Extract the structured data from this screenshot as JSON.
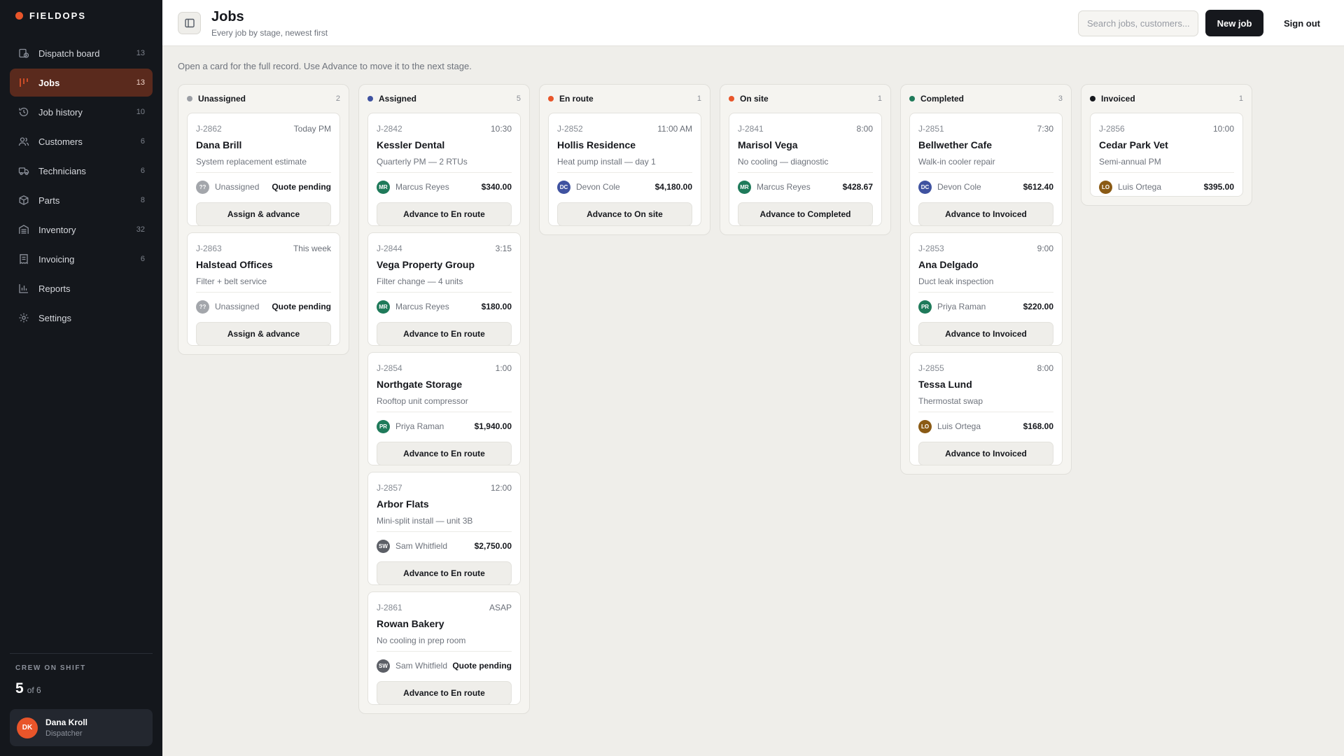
{
  "brand": {
    "name": "FIELDOPS",
    "dot_color": "#e8552a"
  },
  "sidebar": {
    "items": [
      {
        "label": "Dispatch board",
        "count": "13",
        "icon": "clock-board-icon"
      },
      {
        "label": "Jobs",
        "count": "13",
        "icon": "columns-icon",
        "active": true
      },
      {
        "label": "Job history",
        "count": "10",
        "icon": "history-icon"
      },
      {
        "label": "Customers",
        "count": "6",
        "icon": "users-icon"
      },
      {
        "label": "Technicians",
        "count": "6",
        "icon": "truck-icon"
      },
      {
        "label": "Parts",
        "count": "8",
        "icon": "box-icon"
      },
      {
        "label": "Inventory",
        "count": "32",
        "icon": "warehouse-icon"
      },
      {
        "label": "Invoicing",
        "count": "6",
        "icon": "receipt-icon"
      },
      {
        "label": "Reports",
        "count": "",
        "icon": "bar-chart-icon"
      },
      {
        "label": "Settings",
        "count": "",
        "icon": "gear-icon"
      }
    ],
    "crew_label": "CREW ON SHIFT",
    "crew_count": "5",
    "crew_total": "of 6",
    "user": {
      "initials": "DK",
      "name": "Dana Kroll",
      "role": "Dispatcher"
    }
  },
  "header": {
    "title": "Jobs",
    "subtitle": "Every job by stage, newest first",
    "search_placeholder": "Search jobs, customers...",
    "new_job_label": "New job",
    "sign_out_label": "Sign out"
  },
  "hint": "Open a card for the full record. Use Advance to move it to the next stage.",
  "board": [
    {
      "name": "Unassigned",
      "count": "2",
      "color": "#9b9ea4",
      "cards": [
        {
          "id": "J-2862",
          "time": "Today PM",
          "title": "Dana Brill",
          "desc": "System replacement estimate",
          "initials": "??",
          "tech": "Unassigned",
          "avatar_color": "#a3a6ab",
          "price": "Quote pending",
          "action": "Assign & advance"
        },
        {
          "id": "J-2863",
          "time": "This week",
          "title": "Halstead Offices",
          "desc": "Filter + belt service",
          "initials": "??",
          "tech": "Unassigned",
          "avatar_color": "#a3a6ab",
          "price": "Quote pending",
          "action": "Assign & advance"
        }
      ]
    },
    {
      "name": "Assigned",
      "count": "5",
      "color": "#3f52a0",
      "cards": [
        {
          "id": "J-2842",
          "time": "10:30",
          "title": "Kessler Dental",
          "desc": "Quarterly PM — 2 RTUs",
          "initials": "MR",
          "tech": "Marcus Reyes",
          "avatar_color": "#1f7a5a",
          "price": "$340.00",
          "action": "Advance to En route"
        },
        {
          "id": "J-2844",
          "time": "3:15",
          "title": "Vega Property Group",
          "desc": "Filter change — 4 units",
          "initials": "MR",
          "tech": "Marcus Reyes",
          "avatar_color": "#1f7a5a",
          "price": "$180.00",
          "action": "Advance to En route"
        },
        {
          "id": "J-2854",
          "time": "1:00",
          "title": "Northgate Storage",
          "desc": "Rooftop unit compressor",
          "initials": "PR",
          "tech": "Priya Raman",
          "avatar_color": "#1f7a5a",
          "price": "$1,940.00",
          "action": "Advance to En route"
        },
        {
          "id": "J-2857",
          "time": "12:00",
          "title": "Arbor Flats",
          "desc": "Mini-split install — unit 3B",
          "initials": "SW",
          "tech": "Sam Whitfield",
          "avatar_color": "#5c5f66",
          "price": "$2,750.00",
          "action": "Advance to En route"
        },
        {
          "id": "J-2861",
          "time": "ASAP",
          "title": "Rowan Bakery",
          "desc": "No cooling in prep room",
          "initials": "SW",
          "tech": "Sam Whitfield",
          "avatar_color": "#5c5f66",
          "price": "Quote pending",
          "action": "Advance to En route"
        }
      ]
    },
    {
      "name": "En route",
      "count": "1",
      "color": "#e8552a",
      "cards": [
        {
          "id": "J-2852",
          "time": "11:00 AM",
          "title": "Hollis Residence",
          "desc": "Heat pump install — day 1",
          "initials": "DC",
          "tech": "Devon Cole",
          "avatar_color": "#3f52a0",
          "price": "$4,180.00",
          "action": "Advance to On site"
        }
      ]
    },
    {
      "name": "On site",
      "count": "1",
      "color": "#e8552a",
      "cards": [
        {
          "id": "J-2841",
          "time": "8:00",
          "title": "Marisol Vega",
          "desc": "No cooling — diagnostic",
          "initials": "MR",
          "tech": "Marcus Reyes",
          "avatar_color": "#1f7a5a",
          "price": "$428.67",
          "action": "Advance to Completed"
        }
      ]
    },
    {
      "name": "Completed",
      "count": "3",
      "color": "#1f7a5a",
      "cards": [
        {
          "id": "J-2851",
          "time": "7:30",
          "title": "Bellwether Cafe",
          "desc": "Walk-in cooler repair",
          "initials": "DC",
          "tech": "Devon Cole",
          "avatar_color": "#3f52a0",
          "price": "$612.40",
          "action": "Advance to Invoiced"
        },
        {
          "id": "J-2853",
          "time": "9:00",
          "title": "Ana Delgado",
          "desc": "Duct leak inspection",
          "initials": "PR",
          "tech": "Priya Raman",
          "avatar_color": "#1f7a5a",
          "price": "$220.00",
          "action": "Advance to Invoiced"
        },
        {
          "id": "J-2855",
          "time": "8:00",
          "title": "Tessa Lund",
          "desc": "Thermostat swap",
          "initials": "LO",
          "tech": "Luis Ortega",
          "avatar_color": "#8a5a14",
          "price": "$168.00",
          "action": "Advance to Invoiced"
        }
      ]
    },
    {
      "name": "Invoiced",
      "count": "1",
      "color": "#16181d",
      "cards": [
        {
          "id": "J-2856",
          "time": "10:00",
          "title": "Cedar Park Vet",
          "desc": "Semi-annual PM",
          "initials": "LO",
          "tech": "Luis Ortega",
          "avatar_color": "#8a5a14",
          "price": "$395.00",
          "action": ""
        }
      ]
    }
  ]
}
